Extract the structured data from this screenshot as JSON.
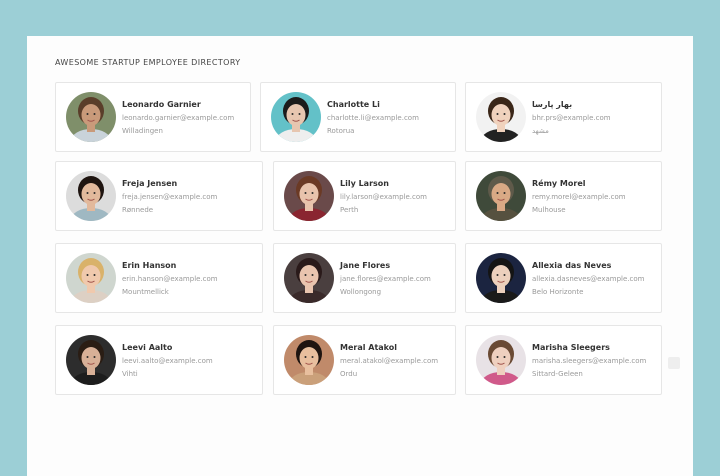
{
  "directory": {
    "title": "AWESOME STARTUP EMPLOYEE DIRECTORY"
  },
  "employees": [
    {
      "name": "Leonardo Garnier",
      "email": "leonardo.garnier@example.com",
      "city": "Willadingen",
      "skin": "#c99a7a",
      "hair": "#5a3e2a",
      "bg": "#7f8f6a",
      "shirt": "#c9d3da"
    },
    {
      "name": "Charlotte Li",
      "email": "charlotte.li@example.com",
      "city": "Rotorua",
      "skin": "#e7c6b0",
      "hair": "#1b1b1b",
      "bg": "#63c1c8",
      "shirt": "#eeeeee"
    },
    {
      "name": "بهار پارسا",
      "email": "bhr.prs@example.com",
      "city": "مشهد",
      "skin": "#f0d2bd",
      "hair": "#3a2618",
      "bg": "#f2f2f2",
      "shirt": "#222222"
    },
    {
      "name": "Freja Jensen",
      "email": "freja.jensen@example.com",
      "city": "Rønnede",
      "skin": "#e2b99c",
      "hair": "#1e1410",
      "bg": "#dcdcdc",
      "shirt": "#9fb8c2"
    },
    {
      "name": "Lily Larson",
      "email": "lily.larson@example.com",
      "city": "Perth",
      "skin": "#e8c3ac",
      "hair": "#6b3a25",
      "bg": "#6a4a4a",
      "shirt": "#8a2530"
    },
    {
      "name": "Rémy Morel",
      "email": "remy.morel@example.com",
      "city": "Mulhouse",
      "skin": "#d9a985",
      "hair": "#5f5a4a",
      "bg": "#3f4a3a",
      "shirt": "#56513f"
    },
    {
      "name": "Erin Hanson",
      "email": "erin.hanson@example.com",
      "city": "Mountmellick",
      "skin": "#f0c9ad",
      "hair": "#d9b26a",
      "bg": "#cfd6cf",
      "shirt": "#ddd0c4"
    },
    {
      "name": "Jane Flores",
      "email": "jane.flores@example.com",
      "city": "Wollongong",
      "skin": "#e9c4ae",
      "hair": "#2a1a1a",
      "bg": "#4a3f3f",
      "shirt": "#3a2a2a"
    },
    {
      "name": "Allexia das Neves",
      "email": "allexia.dasneves@example.com",
      "city": "Belo Horizonte",
      "skin": "#ecd0bd",
      "hair": "#141414",
      "bg": "#1b2440",
      "shirt": "#1a1a1a"
    },
    {
      "name": "Leevi Aalto",
      "email": "leevi.aalto@example.com",
      "city": "Vihti",
      "skin": "#d8b097",
      "hair": "#2a1d14",
      "bg": "#2d2d2d",
      "shirt": "#1d1d1d"
    },
    {
      "name": "Meral Atakol",
      "email": "meral.atakol@example.com",
      "city": "Ordu",
      "skin": "#e8bf9e",
      "hair": "#1e1410",
      "bg": "#c08a6a",
      "shirt": "#caa07a"
    },
    {
      "name": "Marisha Sleegers",
      "email": "marisha.sleegers@example.com",
      "city": "Sittard-Geleen",
      "skin": "#efd0bf",
      "hair": "#6a4a34",
      "bg": "#e8e2e6",
      "shirt": "#d05a8a"
    }
  ]
}
